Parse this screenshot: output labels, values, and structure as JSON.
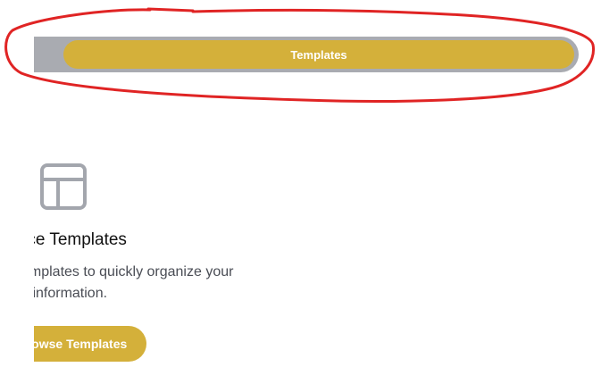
{
  "tabs": {
    "active_label": "Templates"
  },
  "card": {
    "icon": "template-layout-icon",
    "title": "rce Templates",
    "description_line1": "emplates to quickly organize your",
    "description_line2": "y information.",
    "button_label": "rowse Templates"
  },
  "colors": {
    "accent": "#d4b03a",
    "tab_strip": "#a9abb1",
    "annotation": "#e02424",
    "icon": "#a3a6ad"
  }
}
